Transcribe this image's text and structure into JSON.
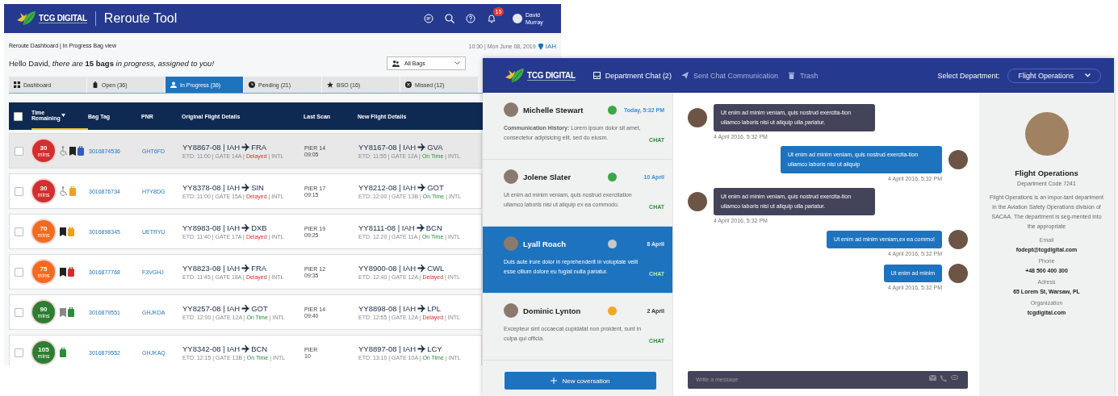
{
  "reroute_window": {
    "logo": "TCG DIGITAL",
    "title": "Reroute Tool",
    "notifications": "15",
    "user": "David Murray",
    "breadcrumb": "Reroute Dashboard | In Progress Bag view",
    "datetime": "10:30 | Mon June 08, 2019",
    "location": "IAH",
    "greeting": "Hello David, *there are* **15 bags** *in progress, assigned to you!*",
    "filter": {
      "value": "All Bags"
    },
    "tabs": [
      {
        "label": "Dashboard",
        "kind": "grid",
        "selected": false
      },
      {
        "label": "Open (36)",
        "kind": "bag",
        "selected": false
      },
      {
        "label": "In Progress (36)",
        "kind": "person",
        "selected": true
      },
      {
        "label": "Pending (21)",
        "kind": "clock",
        "selected": false
      },
      {
        "label": "BSO (16)",
        "kind": "star",
        "selected": false
      },
      {
        "label": "Missed (12)",
        "kind": "cross",
        "selected": false
      }
    ],
    "table": {
      "all_checked": false,
      "columns": [
        "Time Remaining",
        "Bag Tag",
        "PNR",
        "Original Flight Details",
        "Last Scan",
        "New Flight Details"
      ],
      "rows": [
        {
          "selected": true,
          "checked": false,
          "timer": {
            "value": "30",
            "unit": "mins",
            "color": "#d32f2f"
          },
          "icons": [
            {
              "kind": "wheelchair"
            },
            {
              "kind": "tag",
              "color": "#222222"
            },
            {
              "kind": "bag",
              "color": "#2f5fbf"
            }
          ],
          "bag_tag": "3016874536",
          "pnr": "GHT6FD",
          "original": {
            "flight": "YY8867-08 | IAH",
            "dest": "FRA",
            "details": "ETD: 11:00 | GATE 14A |",
            "status": "Delayed",
            "kind": "delayed",
            "suffix": "| INTL"
          },
          "last_scan": [
            "PIER 14",
            "09:05"
          ],
          "new": {
            "flight": "YY8167-08 | IAH",
            "dest": "GVA",
            "details": "ETD: 11:55 | GATE 12A |",
            "status": "On Time",
            "kind": "on_time",
            "suffix": "| INTL"
          }
        },
        {
          "selected": false,
          "checked": false,
          "timer": {
            "value": "30",
            "unit": "mins",
            "color": "#d32f2f"
          },
          "icons": [
            {
              "kind": "wheelchair"
            },
            {
              "kind": "bag",
              "color": "#f0a020"
            }
          ],
          "bag_tag": "3016876734",
          "pnr": "HTY8DG",
          "original": {
            "flight": "YY8378-08 | IAH",
            "dest": "SIN",
            "details": "ETD: 11:00 | GATE 15A |",
            "status": "Delayed",
            "kind": "delayed",
            "suffix": "| INTL"
          },
          "last_scan": [
            "PIER 17",
            "09:15"
          ],
          "new": {
            "flight": "YY8212-08 | IAH",
            "dest": "GOT",
            "details": "ETD: 12:00 | GATE 13B |",
            "status": "On Time",
            "kind": "on_time",
            "suffix": "| INTL"
          }
        },
        {
          "selected": false,
          "checked": false,
          "timer": {
            "value": "70",
            "unit": "mins",
            "color": "#f26b21"
          },
          "icons": [
            {
              "kind": "tag",
              "color": "#222222"
            },
            {
              "kind": "bag",
              "color": "#f0a020"
            }
          ],
          "bag_tag": "3016898345",
          "pnr": "UETRYU",
          "original": {
            "flight": "YY8983-08 | IAH",
            "dest": "DXB",
            "details": "ETD: 11:40 | GATE 17A |",
            "status": "Delayed",
            "kind": "delayed",
            "suffix": "| INTL"
          },
          "last_scan": [
            "PIER 19",
            "09:25"
          ],
          "new": {
            "flight": "YY8111-08 | IAH",
            "dest": "BCN",
            "details": "ETD: 12:20 | GATE 11A |",
            "status": "On Time",
            "kind": "on_time",
            "suffix": "| INTL"
          }
        },
        {
          "selected": false,
          "checked": false,
          "timer": {
            "value": "75",
            "unit": "mins",
            "color": "#f26b21"
          },
          "icons": [
            {
              "kind": "tag",
              "color": "#222222"
            },
            {
              "kind": "bag",
              "color": "#d32f2f"
            }
          ],
          "bag_tag": "3016877768",
          "pnr": "F3VGHJ",
          "original": {
            "flight": "YY8823-08 | IAH",
            "dest": "FRA",
            "details": "ETD: 11:45 | GATE 18A |",
            "status": "Delayed",
            "kind": "delayed",
            "suffix": "| INTL"
          },
          "last_scan": [
            "PIER 12",
            "09:35"
          ],
          "new": {
            "flight": "YY8900-08 | IAH",
            "dest": "CWL",
            "details": "ETD: 12:40 | GATE 12A |",
            "status": "Delayed",
            "kind": "delayed",
            "suffix": "| INTL"
          }
        },
        {
          "selected": false,
          "checked": false,
          "timer": {
            "value": "90",
            "unit": "mins",
            "color": "#2e7d32"
          },
          "icons": [
            {
              "kind": "tag",
              "color": "#888888"
            },
            {
              "kind": "bag",
              "color": "#2e8b3a"
            }
          ],
          "bag_tag": "3016879551",
          "pnr": "GHJKDA",
          "original": {
            "flight": "YY8257-08 | IAH",
            "dest": "GOT",
            "details": "ETD: 12:00 | GATE 12A |",
            "status": "On Time",
            "kind": "on_time",
            "suffix": "| INTL"
          },
          "last_scan": [
            "PIER 14",
            "09:40"
          ],
          "new": {
            "flight": "YY8898-08 | IAH",
            "dest": "LPL",
            "details": "ETD: 12:55 | GATE 12A |",
            "status": "Delayed",
            "kind": "delayed",
            "suffix": "| INTL"
          }
        },
        {
          "selected": false,
          "checked": false,
          "timer": {
            "value": "105",
            "unit": "mins",
            "color": "#2e7d32"
          },
          "icons": [
            {
              "kind": "bag",
              "color": "#2e8b3a"
            }
          ],
          "bag_tag": "3016879552",
          "pnr": "GHJKAQ",
          "original": {
            "flight": "YY8342-08 | IAH",
            "dest": "BCN",
            "details": "ETD: 12:15 | GATE 13B |",
            "status": "On Time",
            "kind": "on_time",
            "suffix": "| INTL"
          },
          "last_scan": [
            "PIER",
            "10"
          ],
          "new": {
            "flight": "YY8897-08 | IAH",
            "dest": "LCY",
            "details": "ETD: 13:10 | GATE 10A |",
            "status": "On Time",
            "kind": "on_time",
            "suffix": "| INTL"
          }
        }
      ]
    }
  },
  "chat_window": {
    "logo": "TCG DIGITAL",
    "nav": [
      {
        "label": "Department Chat (2)",
        "kind": "inbox",
        "selected": true
      },
      {
        "label": "Sent Chat Communication",
        "kind": "send",
        "selected": false
      },
      {
        "label": "Trash",
        "kind": "trash",
        "selected": false
      }
    ],
    "department_label": "Select Department:",
    "department": "Flight Operations",
    "contacts": [
      {
        "name": "Michelle Stewart",
        "color": "#3aa845",
        "date": "Today, 5:32 PM",
        "unread": true,
        "message": "**Communication History:** Lorem ipsum dolor sit amet, consectetur adipisicing elit, sed do eiusm.",
        "tag": "CHAT",
        "selected": false
      },
      {
        "name": "Jolene Slater",
        "color": "#3aa845",
        "date": "10 April",
        "unread": true,
        "message": "Ut enim ad minim veniam, quis nostrud exercitation ullamco laboris nisi ut aliquip ex ea commodo.",
        "tag": "CHAT",
        "selected": false
      },
      {
        "name": "Lyall Roach",
        "color": "#c8c8c8",
        "date": "8 April",
        "unread": false,
        "message": "Duis aute irure dolor in reprehenderit in voluptate velit esse cillum dolore eu fugiat nulla pariatur.",
        "tag": "CHAT",
        "selected": true
      },
      {
        "name": "Dominic Lynton",
        "color": "#f5a623",
        "date": "2 April",
        "unread": false,
        "message": "Excepteur sint occaecat cupidatat non proident, sunt in culpa qui officia.",
        "tag": "CHAT",
        "selected": false
      }
    ],
    "new_button": "New coversation",
    "messages": [
      {
        "kind": "incoming",
        "text": "Ut enim ad minim veniam, quis nostrud exercita-tion ullamco laboris nisi ut aliquip ulla pariatur.",
        "time": "4 April 2016, 5:32 PM"
      },
      {
        "kind": "outgoing",
        "text": "Ut enim ad minim veniam, quis nostrud exercita-tion ullamco laboris nisi ut aliquip",
        "time": "4 April 2016, 5:32 PM"
      },
      {
        "kind": "incoming",
        "text": "Ut enim ad minim veniam, quis nostrud exercita-tion ullamco laboris nisi ut aliquip ulla pariatur.",
        "time": "4 April 2016, 5:32 PM"
      },
      {
        "kind": "outgoing",
        "text": "Ut enim ad minim veniam,ex ea commo!",
        "time": "4 April 2016, 5:32 PM"
      },
      {
        "kind": "outgoing",
        "text": "Ut enim ad minim",
        "time": "4 April 2016, 5:32 PM"
      }
    ],
    "composer": {
      "placeholder": "Write a message"
    },
    "department_info": {
      "name": "Flight Operations",
      "code": "Department Code 7241",
      "description": "Flight Operations is an impor-tant department in the Aviation Safety Operations division of SACAA. The department is seg-mented into the appropriate",
      "fields": [
        {
          "label": "Email",
          "value": "fodept@tcgdigital.com"
        },
        {
          "label": "Phone",
          "value": "+48 500 400 300"
        },
        {
          "label": "Adress",
          "value": "65 Lorem St, Warsaw, PL"
        },
        {
          "label": "Organization",
          "value": "tcgdigital.com"
        }
      ]
    }
  }
}
